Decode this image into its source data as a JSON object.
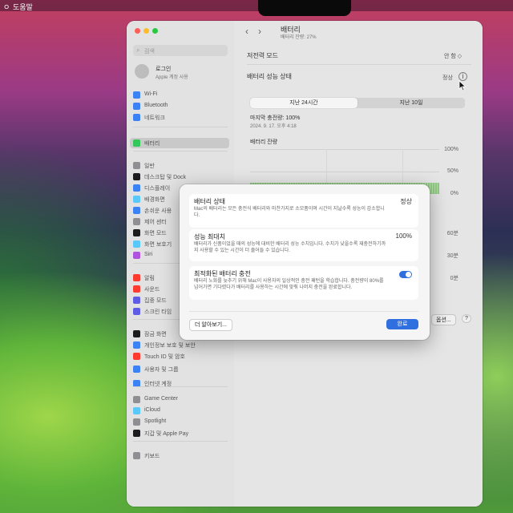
{
  "menubar": {
    "help": "도움말"
  },
  "sidebar": {
    "search_placeholder": "검색",
    "account_name": "로그인",
    "account_sub": "Apple 계정 사용",
    "items": [
      {
        "label": "Wi-Fi",
        "color": "#3b82f6"
      },
      {
        "label": "Bluetooth",
        "color": "#3b82f6"
      },
      {
        "label": "네트워크",
        "color": "#3b82f6"
      },
      {
        "label": "배터리",
        "color": "#34c759"
      },
      {
        "label": "일반",
        "color": "#8e8e93"
      },
      {
        "label": "데스크탑 및 Dock",
        "color": "#1c1c1e"
      },
      {
        "label": "디스플레이",
        "color": "#3b82f6"
      },
      {
        "label": "배경화면",
        "color": "#5ac8fa"
      },
      {
        "label": "손쉬운 사용",
        "color": "#3b82f6"
      },
      {
        "label": "제어 센터",
        "color": "#8e8e93"
      },
      {
        "label": "화면 모드",
        "color": "#1c1c1e"
      },
      {
        "label": "화면 보호기",
        "color": "#5ac8fa"
      },
      {
        "label": "Siri",
        "color": "#af52de"
      },
      {
        "label": "알림",
        "color": "#ff3b30"
      },
      {
        "label": "사운드",
        "color": "#ff3b30"
      },
      {
        "label": "집중 모드",
        "color": "#5e5ce6"
      },
      {
        "label": "스크린 타임",
        "color": "#5e5ce6"
      },
      {
        "label": "잠금 화면",
        "color": "#1c1c1e"
      },
      {
        "label": "개인정보 보호 및 보안",
        "color": "#3b82f6"
      },
      {
        "label": "Touch ID 및 암호",
        "color": "#ff3b30"
      },
      {
        "label": "사용자 및 그룹",
        "color": "#3b82f6"
      },
      {
        "label": "인터넷 계정",
        "color": "#3b82f6"
      },
      {
        "label": "Game Center",
        "color": "#8e8e93"
      },
      {
        "label": "iCloud",
        "color": "#5ac8fa"
      },
      {
        "label": "Spotlight",
        "color": "#8e8e93"
      },
      {
        "label": "지갑 및 Apple Pay",
        "color": "#1c1c1e"
      },
      {
        "label": "키보드",
        "color": "#8e8e93"
      }
    ]
  },
  "main": {
    "title": "배터리",
    "subtitle": "배터리 잔량: 27%",
    "low_power_label": "저전력 모드",
    "low_power_value": "안 함 ◇",
    "health_label": "배터리 성능 상태",
    "health_value": "정상",
    "tabs": [
      "지난 24시간",
      "지난 10일"
    ],
    "last_charge": "마지막 충전량: 100%",
    "last_charge_date": "2024. 9. 17. 오후 4:18",
    "chart_title": "배터리 잔량",
    "axis_pct": [
      "100%",
      "50%",
      "0%"
    ],
    "axis_min": [
      "60분",
      "30분",
      "0분"
    ],
    "options_button": "옵션...",
    "help_button": "?"
  },
  "dialog": {
    "health_title": "배터리 상태",
    "health_value": "정상",
    "health_desc": "Mac의 배터리는 모든 충전식 배터리와 마찬가지로 소모품이며 시간이 지날수록 성능이 감소합니다.",
    "max_title": "성능 최대치",
    "max_value": "100%",
    "max_desc": "배터리가 신품이었을 때의 성능에 대비한 배터리 성능 수치입니다. 수치가 낮을수록 재충전하기까지 사용할 수 있는 시간이 더 줄어들 수 있습니다.",
    "opt_title": "최적화된 배터리 충전",
    "opt_desc": "배터리 노화를 늦추기 위해 Mac이 사용자의 일상적인 충전 패턴을 학습합니다. 충전량이 80%를 넘어가면 기다렸다가 배터리를 사용하는 시간에 맞춰 나머지 충전을 완료합니다.",
    "opt_enabled": true,
    "learn_more": "더 알아보기...",
    "done": "완료"
  },
  "colors": {
    "accent": "#2f6fdf",
    "battery_green": "#7bc36a"
  }
}
